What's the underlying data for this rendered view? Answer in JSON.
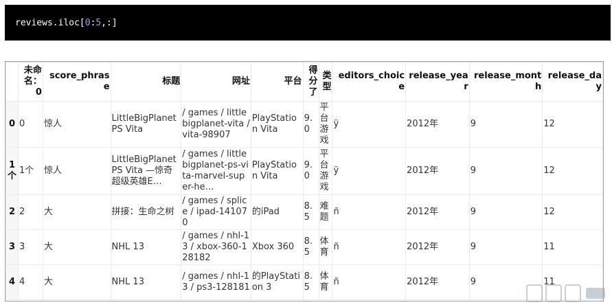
{
  "code": {
    "prefix": "reviews.iloc[",
    "start": "0",
    "colon": ":",
    "end": "5",
    "suffix": ",:]"
  },
  "table": {
    "columns": [
      "未命名：0",
      "score_phrase",
      "标题",
      "网址",
      "平台",
      "得分了",
      "类型",
      "editors_choice",
      "release_year",
      "release_month",
      "release_day"
    ],
    "rows": [
      {
        "index": "0",
        "cells": [
          "0",
          "惊人",
          "LittleBigPlanet PS Vita",
          "/ games / littlebigplanet-vita / vita-98907",
          "PlayStation Vita",
          "9.0",
          "平台游戏",
          "ÿ",
          "2012年",
          "9",
          "12"
        ]
      },
      {
        "index": "1个",
        "cells": [
          "1个",
          "惊人",
          "LittleBigPlanet PS Vita —惊奇超级英雄E…",
          "/ games / littlebigplanet-ps-vita-marvel-super-he…",
          "PlayStation Vita",
          "9.0",
          "平台游戏",
          "ÿ",
          "2012年",
          "9",
          "12"
        ]
      },
      {
        "index": "2",
        "cells": [
          "2",
          "大",
          "拼接：生命之树",
          "/ games / splice / ipad-141070",
          "的iPad",
          "8.5",
          "难题",
          "ñ",
          "2012年",
          "9",
          "12"
        ]
      },
      {
        "index": "3",
        "cells": [
          "3",
          "大",
          "NHL 13",
          "/ games / nhl-13 / xbox-360-128182",
          "Xbox 360",
          "8.5",
          "体育",
          "ñ",
          "2012年",
          "9",
          "11"
        ]
      },
      {
        "index": "4",
        "cells": [
          "4",
          "大",
          "NHL 13",
          "/ games / nhl-13 / ps3-128181",
          "的PlayStation 3",
          "8.5",
          "体育",
          "ñ",
          "2012年",
          "9",
          "11"
        ]
      }
    ]
  },
  "watermark": {
    "text": "ÂÂÂ",
    "color": "#9aa7b5"
  }
}
